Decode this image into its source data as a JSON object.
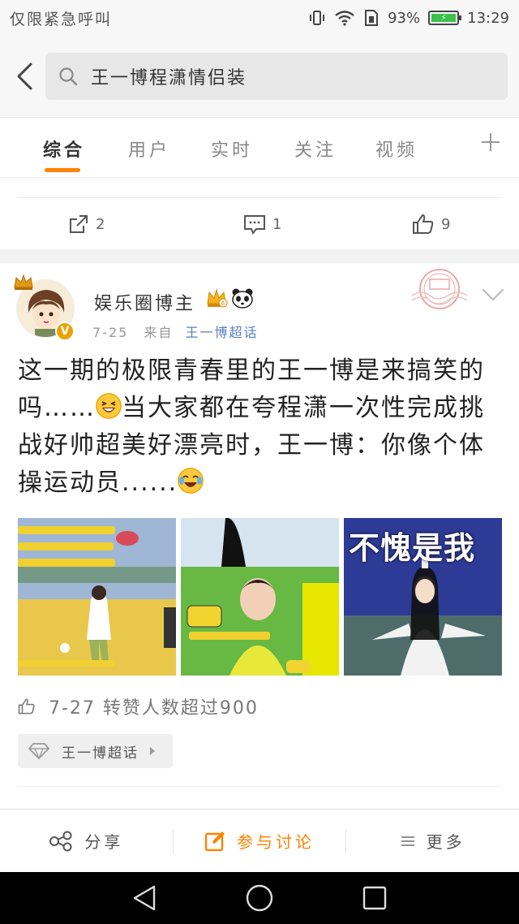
{
  "status_bar": {
    "carrier": "仅限紧急呼叫",
    "battery": "93%",
    "time": "13:29"
  },
  "search": {
    "query": "王一博程潇情侣装"
  },
  "tabs": [
    {
      "label": "综合",
      "active": true
    },
    {
      "label": "用户",
      "active": false
    },
    {
      "label": "实时",
      "active": false
    },
    {
      "label": "关注",
      "active": false
    },
    {
      "label": "视频",
      "active": false
    }
  ],
  "prev_card": {
    "repost_count": "2",
    "comment_count": "1",
    "like_count": "9"
  },
  "post": {
    "author": "娱乐圈博主",
    "date": "7-25",
    "from_label": "来自",
    "source": "王一博超话",
    "text_part1": "这一期的极限青春里的王一博是来搞笑的吗……",
    "text_part2": "当大家都在夸程潇一次性完成挑战好帅超美好漂亮时，王一博：你像个体操运动员......",
    "images": [
      {
        "caption": ""
      },
      {
        "caption": ""
      },
      {
        "caption": "不愧是我"
      }
    ],
    "likes_summary": "7-27 转赞人数超过900",
    "topic": "王一博超话"
  },
  "bottom_bar": {
    "share_label": "分享",
    "discuss_label": "参与讨论",
    "more_label": "更多"
  },
  "colors": {
    "accent": "#ff8200",
    "link": "#5b7fbd",
    "battery_green": "#3cc24a"
  }
}
